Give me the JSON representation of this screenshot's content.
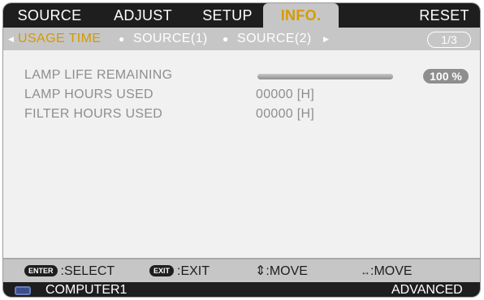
{
  "tabs": [
    {
      "label": "SOURCE",
      "active": false
    },
    {
      "label": "ADJUST",
      "active": false
    },
    {
      "label": "SETUP",
      "active": false
    },
    {
      "label": "INFO.",
      "active": true
    },
    {
      "label": "RESET",
      "active": false
    }
  ],
  "subtabs": [
    {
      "label": "USAGE TIME",
      "active": true
    },
    {
      "label": "SOURCE(1)",
      "active": false
    },
    {
      "label": "SOURCE(2)",
      "active": false
    }
  ],
  "page_indicator": "1/3",
  "info": {
    "lamp_life_label": "LAMP LIFE REMAINING",
    "lamp_life_percent_text": "100 %",
    "lamp_life_fraction": 1.0,
    "lamp_hours_label": "LAMP HOURS USED",
    "lamp_hours_value": "00000 [H]",
    "filter_hours_label": "FILTER HOURS USED",
    "filter_hours_value": "00000 [H]"
  },
  "footer": {
    "enter_key": "ENTER",
    "select_label": ":SELECT",
    "exit_key": "EXIT",
    "exit_label": ":EXIT",
    "move_v_symbol": "⇕",
    "move_v_label": ":MOVE",
    "move_h_symbol": "↔",
    "move_h_label": ":MOVE",
    "input_icon": "computer-input-icon",
    "source": "COMPUTER1",
    "mode": "ADVANCED"
  },
  "colors": {
    "accent": "#d79b00",
    "dark_bar": "#1e1e1e",
    "panel": "#c6c6c6"
  }
}
